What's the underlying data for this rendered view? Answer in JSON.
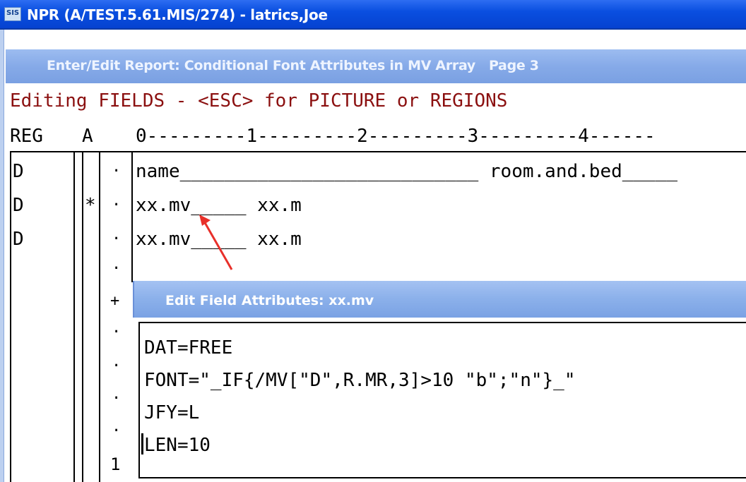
{
  "window": {
    "icon_label": "SIS",
    "title": "NPR (A/TEST.5.61.MIS/274) - latrics,Joe"
  },
  "report_header": {
    "title": "Enter/Edit Report: Conditional Font Attributes in MV Array",
    "page_label": "Page 3"
  },
  "editor": {
    "mode_message": "Editing FIELDS - <ESC> for PICTURE or REGIONS",
    "columns": {
      "reg": "REG",
      "a": "A",
      "ruler": "0---------1---------2---------3---------4------"
    },
    "rows": [
      {
        "reg": "D",
        "a": "",
        "marker": "·",
        "content": "name___________________________ room.and.bed_____"
      },
      {
        "reg": "D",
        "a": "*",
        "marker": "·",
        "content": "xx.mv_____ xx.m"
      },
      {
        "reg": "D",
        "a": "",
        "marker": "·",
        "content": "xx.mv_____ xx.m"
      }
    ],
    "gutter_markers": [
      "·",
      "+",
      "·",
      "·",
      "·",
      "·",
      "1"
    ]
  },
  "dialog": {
    "title": "Edit Field Attributes: xx.mv",
    "lines": [
      "DAT=FREE",
      "FONT=\"_IF{/MV[\"D\",R.MR,3]>10 \"b\";\"n\"}_\"",
      "JFY=L",
      "LEN=10"
    ]
  },
  "colors": {
    "title_bar": "#0a4fe0",
    "header_bar": "#86aae8",
    "heading_text": "#8b1010",
    "annotation_arrow": "#e8302a"
  }
}
